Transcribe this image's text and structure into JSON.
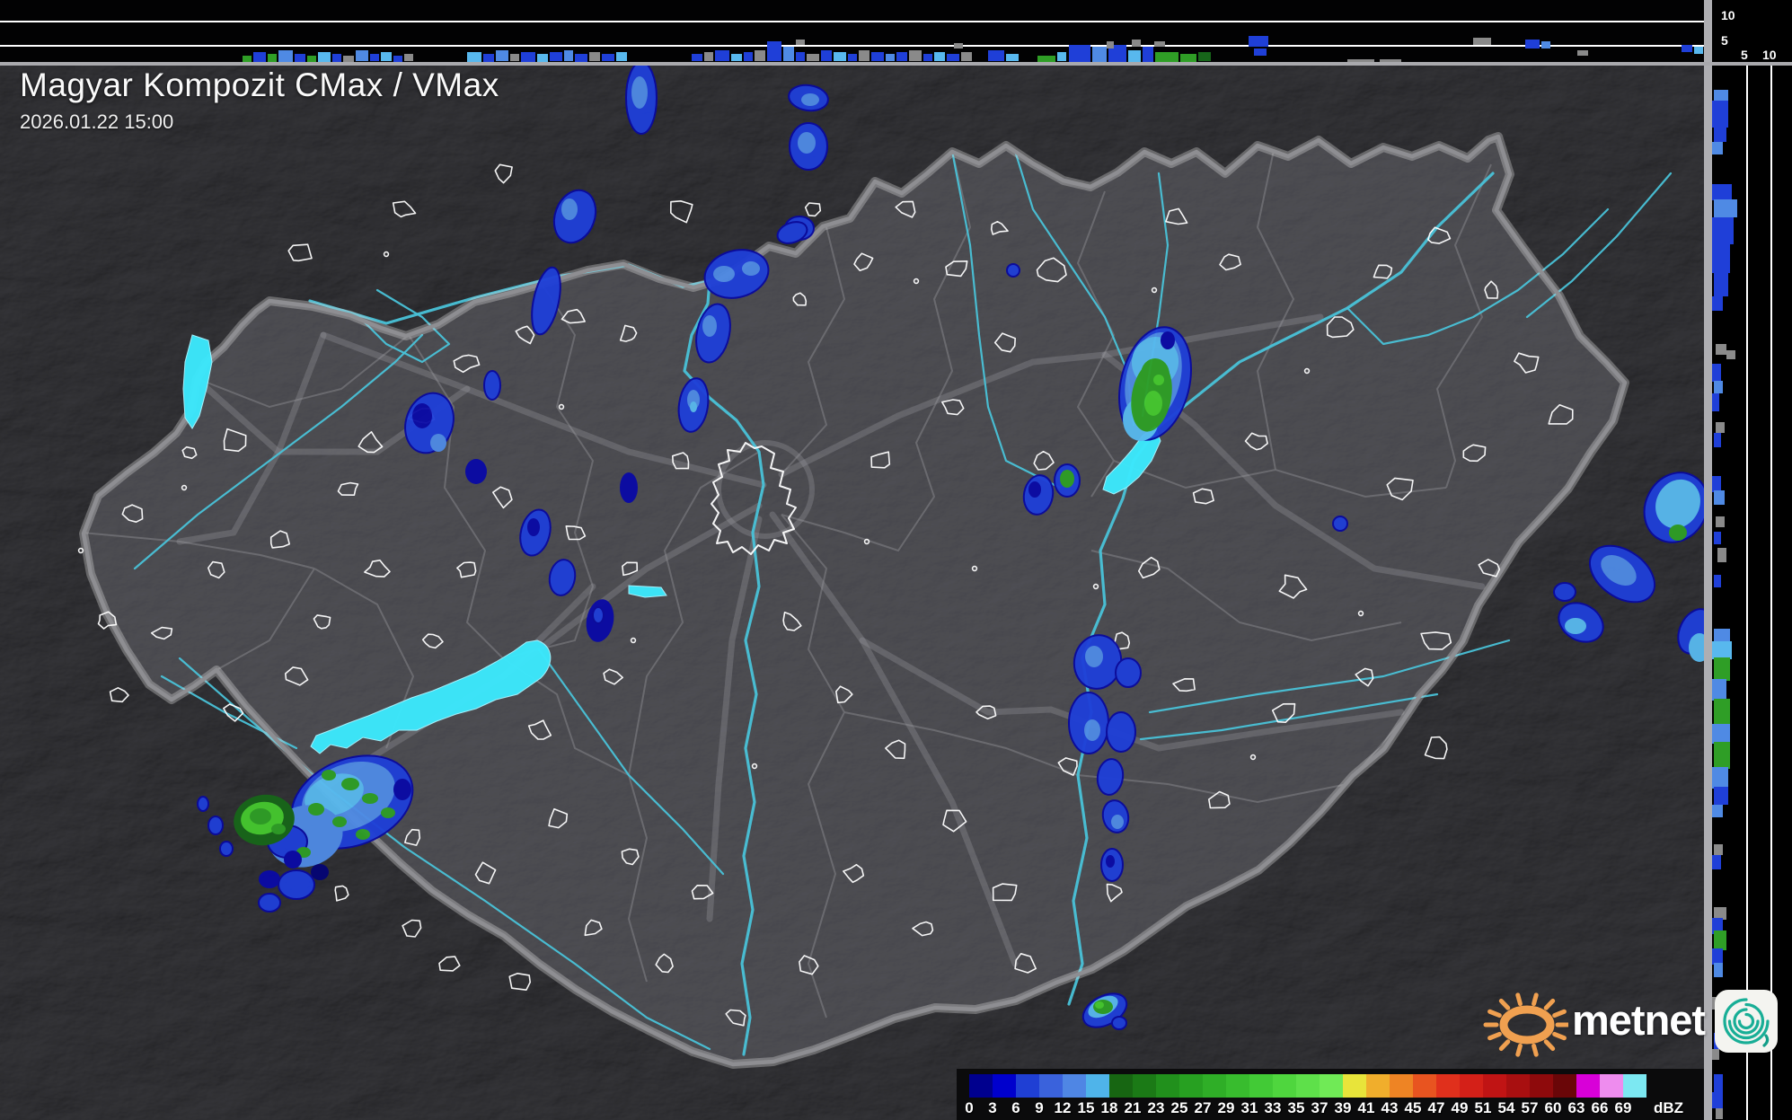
{
  "header": {
    "title": "Magyar Kompozit CMax / VMax",
    "timestamp": "2026.01.22 15:00"
  },
  "profile_axes": {
    "top_labels": [
      "10",
      "5"
    ],
    "right_labels": [
      "5",
      "10"
    ]
  },
  "legend": {
    "unit": "dBZ",
    "tick_labels": [
      "0",
      "3",
      "6",
      "9",
      "12",
      "15",
      "18",
      "21",
      "23",
      "25",
      "27",
      "29",
      "31",
      "33",
      "35",
      "37",
      "39",
      "41",
      "43",
      "45",
      "47",
      "49",
      "51",
      "54",
      "57",
      "60",
      "63",
      "66",
      "69"
    ],
    "colors": [
      "#00008e",
      "#0000cd",
      "#1f3fd4",
      "#3a62dc",
      "#4f86e4",
      "#4fb4ea",
      "#176612",
      "#1b7a16",
      "#21901c",
      "#27a021",
      "#2fae27",
      "#38bc2e",
      "#42ca36",
      "#4fd63e",
      "#5ee04a",
      "#70ea56",
      "#e8e43a",
      "#f0ae2c",
      "#ee8424",
      "#e85420",
      "#e0301c",
      "#d42018",
      "#c01414",
      "#a80f10",
      "#8e0a0c",
      "#6a0608",
      "#d800d8",
      "#ee8cee",
      "#7ce8f2"
    ]
  },
  "logo": {
    "text": "metnet",
    "sun_color": "#f0a050",
    "spiral_color": "#18ae96"
  },
  "palette": {
    "echo": [
      "#0a0aa6",
      "#1f3fd8",
      "#4f8ae4",
      "#58b8ee",
      "#2f9e26",
      "#17661a",
      "#8a8a8a",
      "#c8c8c8",
      "#050575",
      "#46c82e"
    ],
    "lake": "#3ce8fc",
    "river": "#49c2d8",
    "border": "#8e8e92",
    "border_halo": "#d8d8d8",
    "county": "#6e6e72",
    "road": "#a0a0a6",
    "settlement": "#ffffff",
    "gridline": "#ffffff"
  }
}
